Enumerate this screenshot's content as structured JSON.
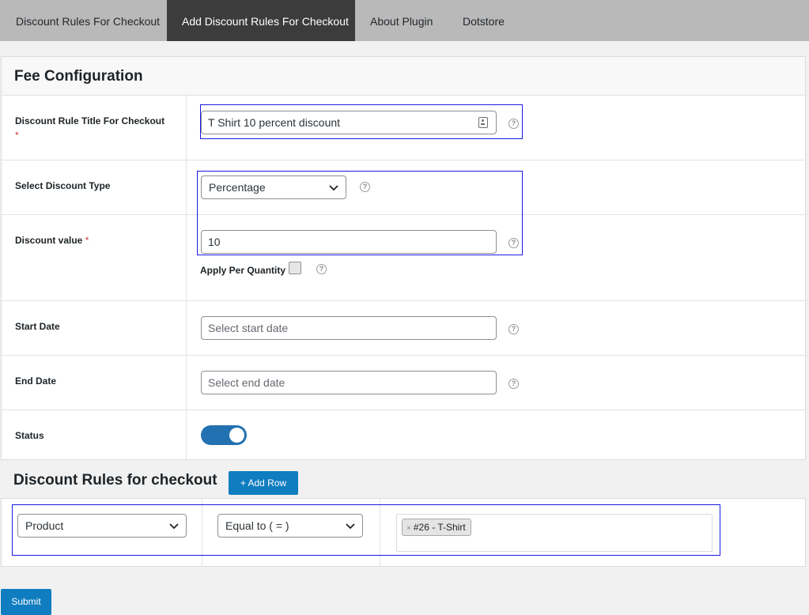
{
  "tabs": [
    {
      "label": "Discount Rules For Checkout"
    },
    {
      "label": "Add Discount Rules For Checkout"
    },
    {
      "label": "About Plugin"
    },
    {
      "label": "Dotstore"
    }
  ],
  "active_tab_index": 1,
  "fee_config": {
    "title": "Fee Configuration",
    "rule_title": {
      "label": "Discount Rule Title For Checkout",
      "required_mark": "*",
      "value": "T Shirt 10 percent discount",
      "help": "?"
    },
    "discount_type": {
      "label": "Select Discount Type",
      "value": "Percentage",
      "help": "?"
    },
    "discount_value": {
      "label": "Discount value",
      "required_mark": "*",
      "value": "10",
      "help": "?"
    },
    "apply_per_quantity": {
      "label": "Apply Per Quantity",
      "checked": false,
      "help": "?"
    },
    "start_date": {
      "label": "Start Date",
      "placeholder": "Select start date",
      "help": "?"
    },
    "end_date": {
      "label": "End Date",
      "placeholder": "Select end date",
      "help": "?"
    },
    "status": {
      "label": "Status",
      "on": true
    }
  },
  "rules": {
    "title": "Discount Rules for checkout",
    "add_row_label": "+ Add Row",
    "condition": "Product",
    "operator": "Equal to ( = )",
    "tag_remove": "×",
    "tag_label": "#26 - T-Shirt"
  },
  "submit_label": "Submit",
  "colors": {
    "active_tab_bg": "#3c3c3c",
    "tabbar_bg": "#b9b9b9",
    "primary_button": "#0f7dc0",
    "toggle_on": "#2271b1",
    "highlight_box": "#1a1ae6",
    "required": "#d63638"
  },
  "icons": {
    "select_arrow": "chevron-down-icon",
    "help": "help-circle-icon",
    "field_autofill": "contact-card-icon"
  }
}
